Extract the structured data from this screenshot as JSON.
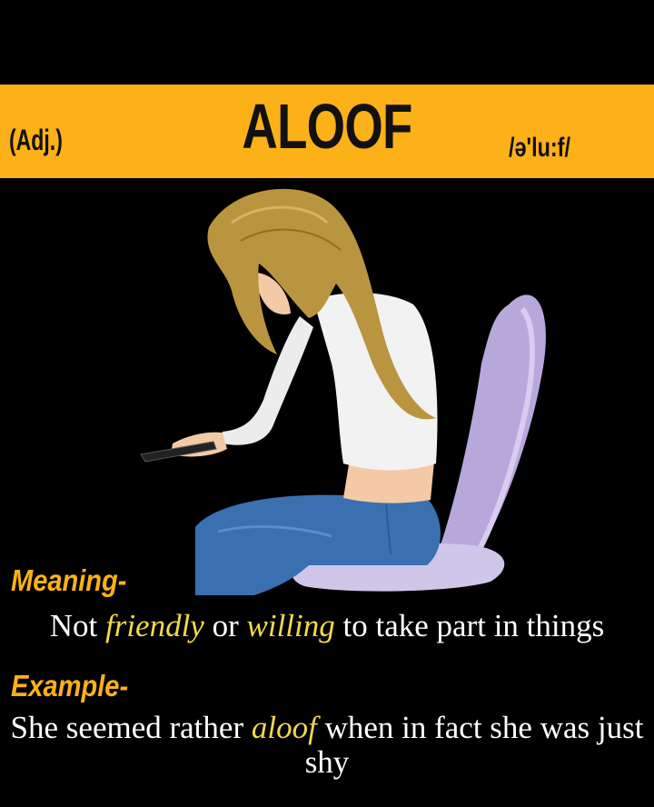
{
  "card": {
    "word": "ALOOF",
    "part_of_speech": "(Adj.)",
    "pronunciation": "/ə'lu:f/",
    "meaning_label": "Meaning-",
    "meaning": {
      "pre": "Not ",
      "hl1": "friendly",
      "mid": " or ",
      "hl2": "willing",
      "post": " to take part in things"
    },
    "example_label": "Example-",
    "example": {
      "pre": "She seemed rather ",
      "hl": "aloof",
      "post": " when in fact she was just shy"
    }
  },
  "colors": {
    "banner": "#fbb117",
    "background": "#000000",
    "highlight": "#f2d84f"
  },
  "illustration": "girl-looking-at-phone-on-chair"
}
